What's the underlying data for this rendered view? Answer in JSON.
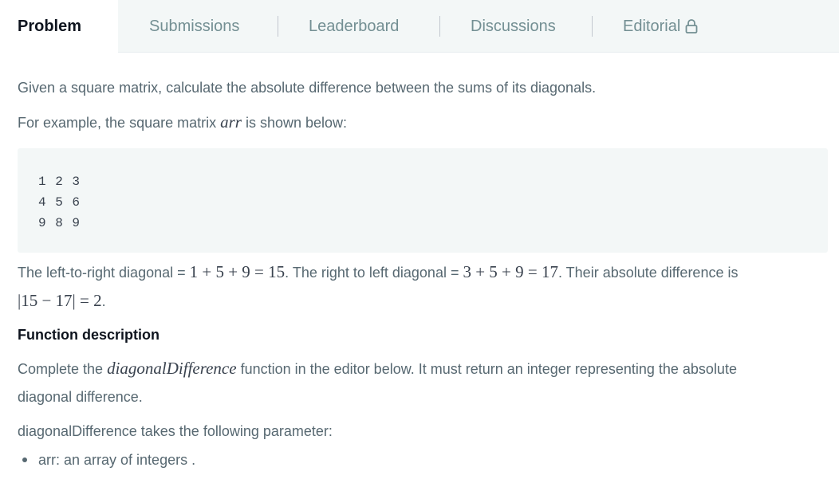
{
  "tabs": [
    {
      "label": "Problem",
      "active": true
    },
    {
      "label": "Submissions",
      "active": false
    },
    {
      "label": "Leaderboard",
      "active": false
    },
    {
      "label": "Discussions",
      "active": false
    },
    {
      "label": "Editorial",
      "active": false,
      "icon": "lock-icon"
    }
  ],
  "problem": {
    "intro": "Given a square matrix, calculate the absolute difference between the sums of its diagonals.",
    "example_prefix": "For example, the square matrix ",
    "example_var": "arr",
    "example_suffix": " is shown below:",
    "matrix": [
      "1 2 3",
      "4 5 6",
      "9 8 9"
    ],
    "diag_text_1": "The left-to-right diagonal = ",
    "diag_math_1": "1 + 5 + 9 = 15",
    "diag_text_2": ". The right to left diagonal = ",
    "diag_math_2": "3 + 5 + 9 = 17",
    "diag_text_3": ". Their absolute difference is",
    "diff_math": "|15 − 17| = 2",
    "diff_suffix": ".",
    "function_heading": "Function description",
    "func_prefix": "Complete the ",
    "func_name": "diagonalDifference",
    "func_suffix": " function in the editor below. It must return an integer representing the absolute",
    "func_line2": "diagonal difference.",
    "params_intro": "diagonalDifference takes the following parameter:",
    "params": [
      "arr: an array of integers ."
    ]
  },
  "colors": {
    "tab_bar_bg": "#f3f7f7",
    "code_bg": "#f3f7f7",
    "text": "#576871",
    "active_tab_text": "#0e141e",
    "inactive_tab_text": "#738f93"
  }
}
